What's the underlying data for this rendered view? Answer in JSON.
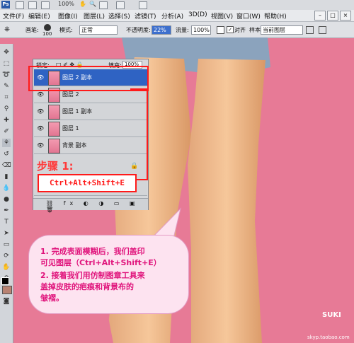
{
  "appbar": {
    "zoom": "100%"
  },
  "menu": {
    "items": [
      "文件(F)",
      "编辑(E)",
      "图像(I)",
      "图层(L)",
      "选择(S)",
      "滤镜(T)",
      "分析(A)",
      "3D(D)",
      "视图(V)",
      "窗口(W)",
      "帮助(H)"
    ]
  },
  "options": {
    "brush_label": "画笔:",
    "brush_size": "100",
    "mode_label": "模式:",
    "mode_value": "正常",
    "opacity_label": "不透明度:",
    "opacity_value": "22%",
    "flow_label": "流量:",
    "flow_value": "100%",
    "align_label": "对齐",
    "sample_label": "样本:",
    "sample_value": "当前图层"
  },
  "layers": {
    "lock_label": "锁定:",
    "fill_label": "填充:",
    "fill_value": "100%",
    "rows": [
      "图层 2 副本",
      "图层 2",
      "图层 1 副本",
      "图层 1",
      "背景 副本"
    ]
  },
  "annotation": {
    "step": "步骤 1:",
    "shortcut": "Ctrl+Alt+Shift+E",
    "lines": [
      "1. 完成表面模糊后，我们盖印",
      "    可见图层（Ctrl+Alt+Shift+E）",
      "2. 接着我们用仿制图章工具来",
      "    盖掉皮肤的疤痕和背景布的",
      "    皱褶。"
    ]
  },
  "watermark": {
    "brand": "SUKI",
    "url": "skyp.taobao.com"
  }
}
